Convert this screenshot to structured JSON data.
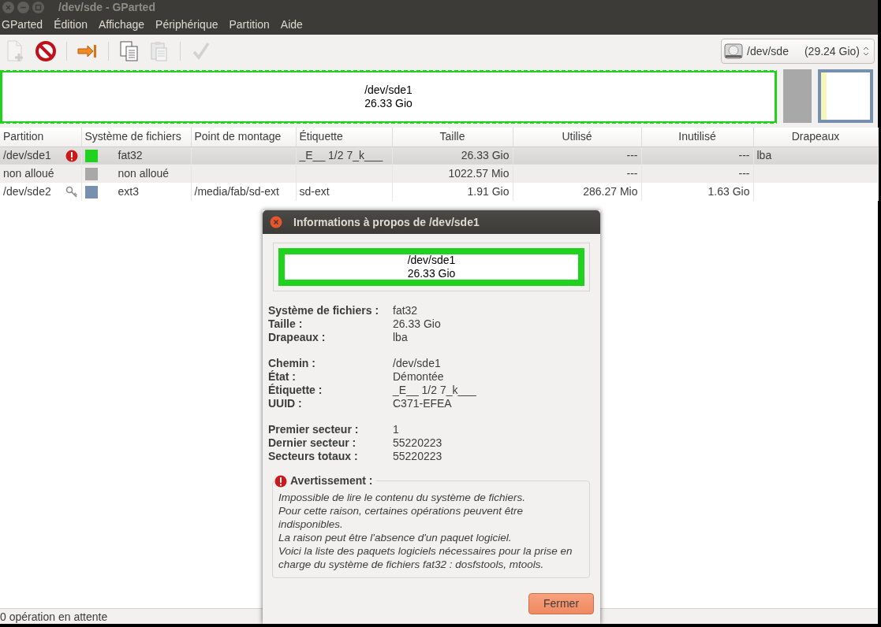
{
  "window": {
    "title": "/dev/sde - GParted"
  },
  "menu": [
    "GParted",
    "Édition",
    "Affichage",
    "Périphérique",
    "Partition",
    "Aide"
  ],
  "toolbar": [
    {
      "kind": "new",
      "disabled": true
    },
    {
      "kind": "delete",
      "disabled": false
    },
    {
      "kind": "resize",
      "disabled": false
    },
    {
      "kind": "copy",
      "disabled": false
    },
    {
      "kind": "paste",
      "disabled": true
    },
    {
      "kind": "apply",
      "disabled": true
    }
  ],
  "device_selector": {
    "device": "/dev/sde",
    "size": "(29.24 Gio)"
  },
  "disk_map": [
    {
      "kind": "partition",
      "label": "/dev/sde1",
      "size": "26.33 Gio",
      "color": "#1ed21e",
      "selected": true
    },
    {
      "kind": "unallocated",
      "color": "#a8a8a8",
      "selected": false
    },
    {
      "kind": "partition",
      "color": "#7890b0",
      "selected": false,
      "level": 0.12
    }
  ],
  "table": {
    "columns": [
      "Partition",
      "Système de fichiers",
      "Point de montage",
      "Étiquette",
      "Taille",
      "Utilisé",
      "Inutilisé",
      "Drapeaux"
    ],
    "rows": [
      {
        "partition": "/dev/sde1",
        "kind": "warning",
        "color": "#1ed21e",
        "filesystem": "fat32",
        "mount": "",
        "label": "_E__ 1/2 7_k___",
        "size": "26.33 Gio",
        "used": "---",
        "unused": "---",
        "flags": "lba",
        "selected": true
      },
      {
        "partition": "non alloué",
        "kind": "plain",
        "color": "#a8a8a8",
        "filesystem": "non alloué",
        "mount": "",
        "label": "",
        "size": "1022.57 Mio",
        "used": "---",
        "unused": "---",
        "flags": "",
        "selected": false
      },
      {
        "partition": "/dev/sde2",
        "kind": "key",
        "color": "#7890b0",
        "filesystem": "ext3",
        "mount": "/media/fab/sd-ext",
        "label": "sd-ext",
        "size": "1.91 Gio",
        "used": "286.27 Mio",
        "unused": "1.63 Gio",
        "flags": "",
        "selected": false
      }
    ]
  },
  "status_bar": "0 opération en attente",
  "dialog": {
    "title": "Informations à propos de /dev/sde1",
    "map": {
      "label": "/dev/sde1",
      "size": "26.33 Gio",
      "color": "#1ed21e"
    },
    "groups": [
      [
        {
          "label": "Système de fichiers :",
          "value": "fat32"
        },
        {
          "label": "Taille :",
          "value": "26.33 Gio"
        },
        {
          "label": "Drapeaux :",
          "value": "lba"
        }
      ],
      [
        {
          "label": "Chemin :",
          "value": "/dev/sde1"
        },
        {
          "label": "État :",
          "value": "Démontée"
        },
        {
          "label": "Étiquette :",
          "value": "_E__ 1/2 7_k___"
        },
        {
          "label": "UUID :",
          "value": "C371-EFEA"
        }
      ],
      [
        {
          "label": "Premier secteur :",
          "value": "1"
        },
        {
          "label": "Dernier secteur :",
          "value": "55220223"
        },
        {
          "label": "Secteurs totaux :",
          "value": "55220223"
        }
      ]
    ],
    "warning": {
      "title": "Avertissement :",
      "lines": [
        "Impossible de lire le contenu du système de fichiers.",
        "Pour cette raison, certaines opérations peuvent être indisponibles.",
        "La raison peut être l'absence d'un paquet logiciel.",
        "Voici la liste des paquets logiciels nécessaires pour la prise en charge du système de fichiers fat32 : dosfstools, mtools."
      ]
    },
    "button": "Fermer"
  }
}
